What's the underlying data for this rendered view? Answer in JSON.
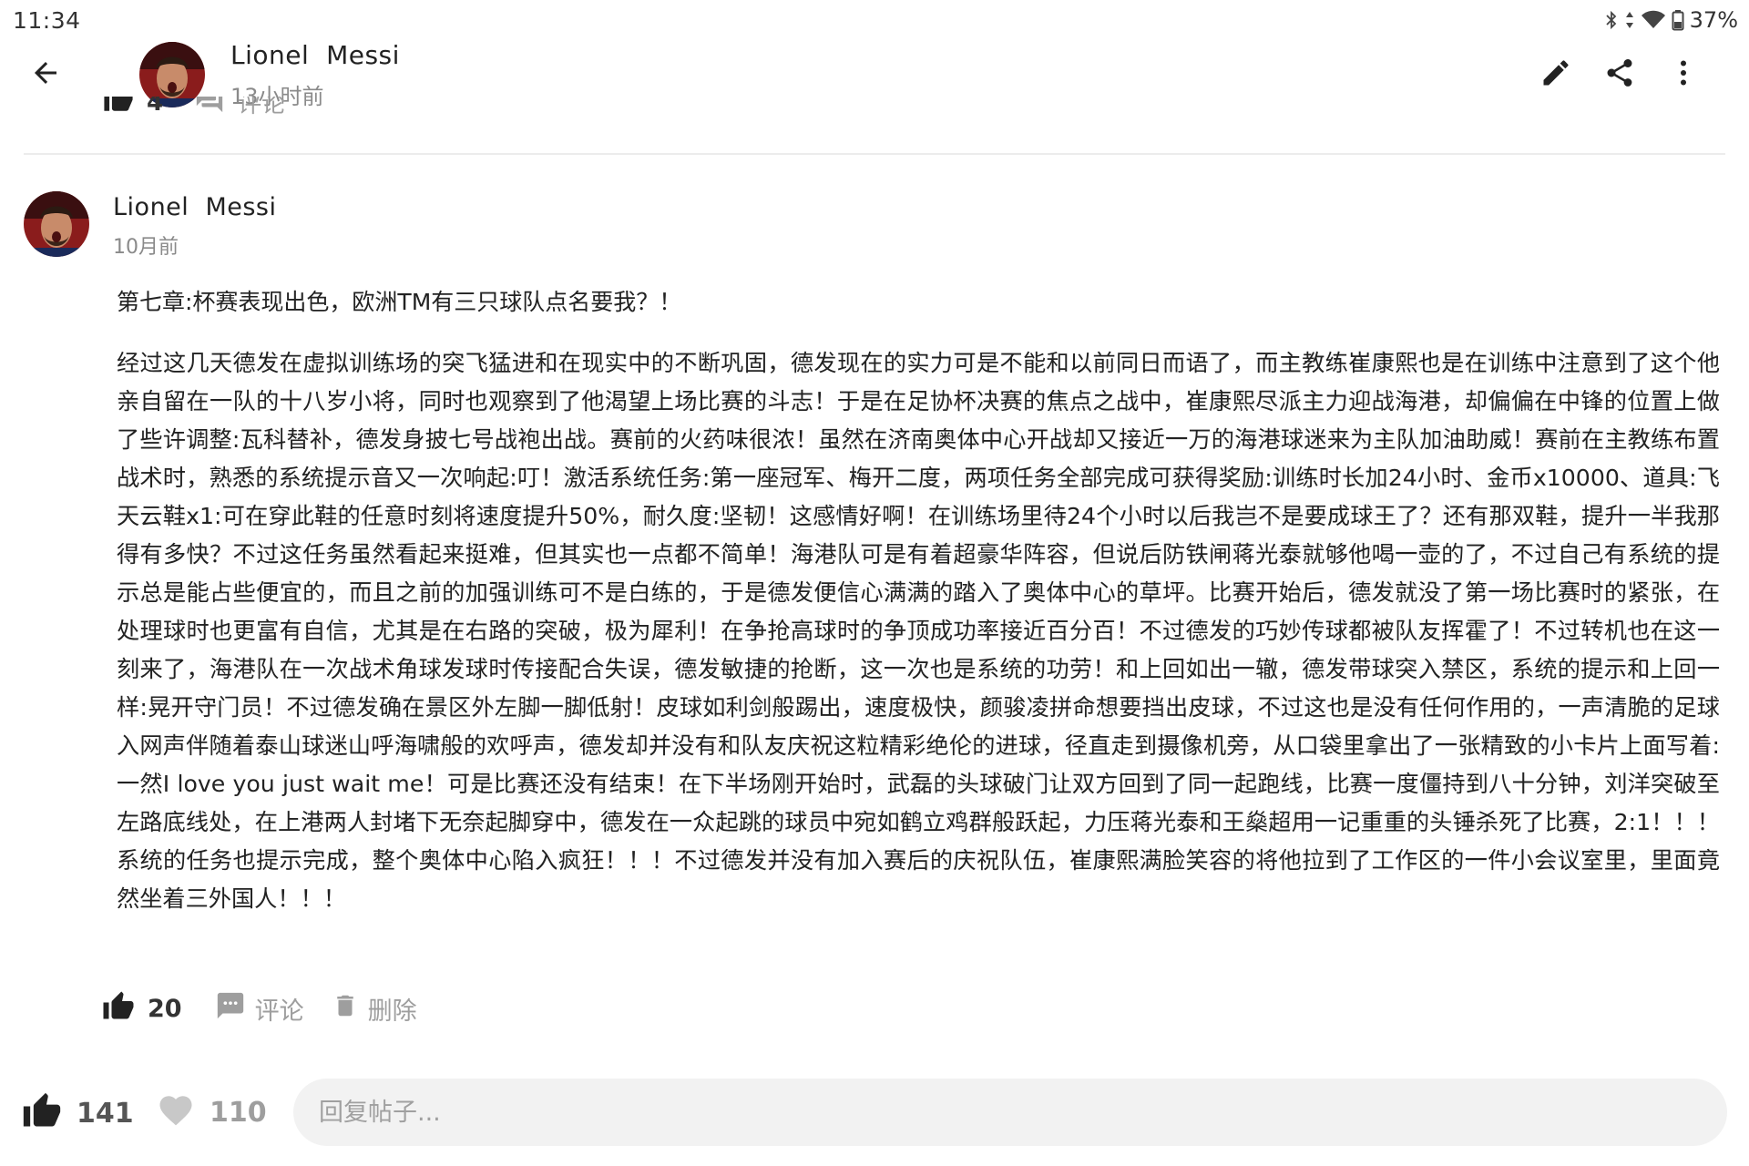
{
  "status_bar": {
    "time": "11:34",
    "battery": "37%",
    "icons": [
      "bluetooth-icon",
      "data-arrows-icon",
      "wifi-icon",
      "battery-icon"
    ]
  },
  "app_bar": {
    "author_name": "Lionel  Messi",
    "time_ago": "13小时前",
    "icons": [
      "back-arrow-icon",
      "edit-pencil-icon",
      "share-icon",
      "more-vert-icon"
    ]
  },
  "previous_comment": {
    "like_count": "4",
    "comment_label": "评论"
  },
  "post": {
    "author_name": "Lionel  Messi",
    "time_ago": "10月前",
    "title": "第七章:杯赛表现出色，欧洲TM有三只球队点名要我？！",
    "body": "经过这几天德发在虚拟训练场的突飞猛进和在现实中的不断巩固，德发现在的实力可是不能和以前同日而语了，而主教练崔康熙也是在训练中注意到了这个他亲自留在一队的十八岁小将，同时也观察到了他渴望上场比赛的斗志！于是在足协杯决赛的焦点之战中，崔康熙尽派主力迎战海港，却偏偏在中锋的位置上做了些许调整:瓦科替补，德发身披七号战袍出战。赛前的火药味很浓！虽然在济南奥体中心开战却又接近一万的海港球迷来为主队加油助威！赛前在主教练布置战术时，熟悉的系统提示音又一次响起:叮！激活系统任务:第一座冠军、梅开二度，两项任务全部完成可获得奖励:训练时长加24小时、金币x10000、道具:飞天云鞋x1:可在穿此鞋的任意时刻将速度提升50%，耐久度:坚韧！这感情好啊！在训练场里待24个小时以后我岂不是要成球王了？还有那双鞋，提升一半我那得有多快？不过这任务虽然看起来挺难，但其实也一点都不简单！海港队可是有着超豪华阵容，但说后防铁闸蒋光泰就够他喝一壶的了，不过自己有系统的提示总是能占些便宜的，而且之前的加强训练可不是白练的，于是德发便信心满满的踏入了奥体中心的草坪。比赛开始后，德发就没了第一场比赛时的紧张，在处理球时也更富有自信，尤其是在右路的突破，极为犀利！在争抢高球时的争顶成功率接近百分百！不过德发的巧妙传球都被队友挥霍了！不过转机也在这一刻来了，海港队在一次战术角球发球时传接配合失误，德发敏捷的抢断，这一次也是系统的功劳！和上回如出一辙，德发带球突入禁区，系统的提示和上回一样:晃开守门员！不过德发确在景区外左脚一脚低射！皮球如利剑般踢出，速度极快，颜骏凌拼命想要挡出皮球，不过这也是没有任何作用的，一声清脆的足球入网声伴随着泰山球迷山呼海啸般的欢呼声，德发却并没有和队友庆祝这粒精彩绝伦的进球，径直走到摄像机旁，从口袋里拿出了一张精致的小卡片上面写着:一然I love you just wait me！可是比赛还没有结束！在下半场刚开始时，武磊的头球破门让双方回到了同一起跑线，比赛一度僵持到八十分钟，刘洋突破至左路底线处，在上港两人封堵下无奈起脚穿中，德发在一众起跳的球员中宛如鹤立鸡群般跃起，力压蒋光泰和王燊超用一记重重的头锤杀死了比赛，2:1！！！系统的任务也提示完成，整个奥体中心陷入疯狂！！！不过德发并没有加入赛后的庆祝队伍，崔康熙满脸笑容的将他拉到了工作区的一件小会议室里，里面竟然坐着三外国人！！！",
    "like_count": "20",
    "comment_label": "评论",
    "delete_label": "删除"
  },
  "bottom_bar": {
    "like_count": "141",
    "favorite_count": "110",
    "reply_placeholder": "回复帖子..."
  },
  "colors": {
    "text_primary": "#222222",
    "text_secondary": "#8a8a8a",
    "icon_gray": "#9e9e9e",
    "icon_dark": "#222222",
    "input_bg": "#f2f2f2",
    "divider": "#ececec"
  }
}
